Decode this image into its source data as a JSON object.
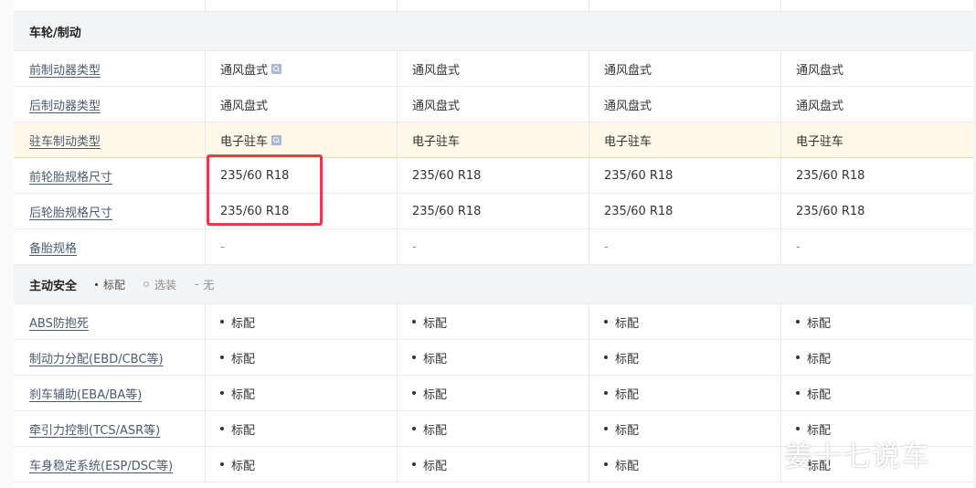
{
  "section_wheels": {
    "title": "车轮/制动"
  },
  "wheel_rows": [
    {
      "label": "前制动器类型",
      "values": [
        "通风盘式",
        "通风盘式",
        "通风盘式",
        "通风盘式"
      ],
      "has_search": true
    },
    {
      "label": "后制动器类型",
      "values": [
        "通风盘式",
        "通风盘式",
        "通风盘式",
        "通风盘式"
      ],
      "has_search": false
    },
    {
      "label": "驻车制动类型",
      "values": [
        "电子驻车",
        "电子驻车",
        "电子驻车",
        "电子驻车"
      ],
      "has_search": true,
      "highlight": true
    },
    {
      "label": "前轮胎规格尺寸",
      "values": [
        "235/60 R18",
        "235/60 R18",
        "235/60 R18",
        "235/60 R18"
      ],
      "has_search": false
    },
    {
      "label": "后轮胎规格尺寸",
      "values": [
        "235/60 R18",
        "235/60 R18",
        "235/60 R18",
        "235/60 R18"
      ],
      "has_search": false
    },
    {
      "label": "备胎规格",
      "values": [
        "-",
        "-",
        "-",
        "-"
      ],
      "has_search": false
    }
  ],
  "section_safety": {
    "title": "主动安全",
    "legend": {
      "standard": "标配",
      "optional": "选装",
      "none": "无"
    }
  },
  "safety_rows": [
    {
      "label": "ABS防抱死",
      "values": [
        "标配",
        "标配",
        "标配",
        "标配"
      ]
    },
    {
      "label": "制动力分配(EBD/CBC等)",
      "values": [
        "标配",
        "标配",
        "标配",
        "标配"
      ]
    },
    {
      "label": "刹车辅助(EBA/BA等)",
      "values": [
        "标配",
        "标配",
        "标配",
        "标配"
      ]
    },
    {
      "label": "牵引力控制(TCS/ASR等)",
      "values": [
        "标配",
        "标配",
        "标配",
        "标配"
      ]
    },
    {
      "label": "车身稳定系统(ESP/DSC等)",
      "values": [
        "标配",
        "标配",
        "标配",
        "标配"
      ]
    }
  ],
  "watermark": "姜十七说车",
  "colors": {
    "highlight_row": "#fff8e8",
    "section_bg": "#f3f4f6",
    "annotation_box": "#e83a4c",
    "link": "#4a5a6f"
  }
}
